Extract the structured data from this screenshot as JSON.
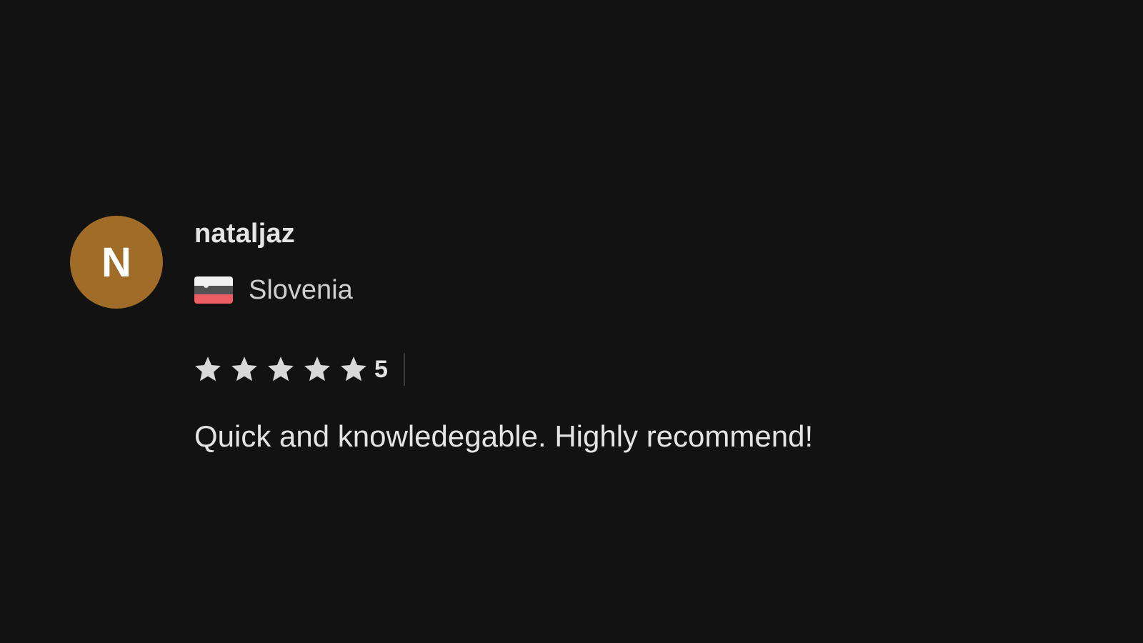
{
  "review": {
    "avatar_initial": "N",
    "avatar_color": "#a06c28",
    "username": "nataljaz",
    "country": "Slovenia",
    "country_flag_icon": "slovenia-flag-icon",
    "rating": 5,
    "rating_label": "5",
    "rating_max": 5,
    "star_color": "#d8d8d8",
    "text": "Quick and knowledegable. Highly recommend!"
  }
}
